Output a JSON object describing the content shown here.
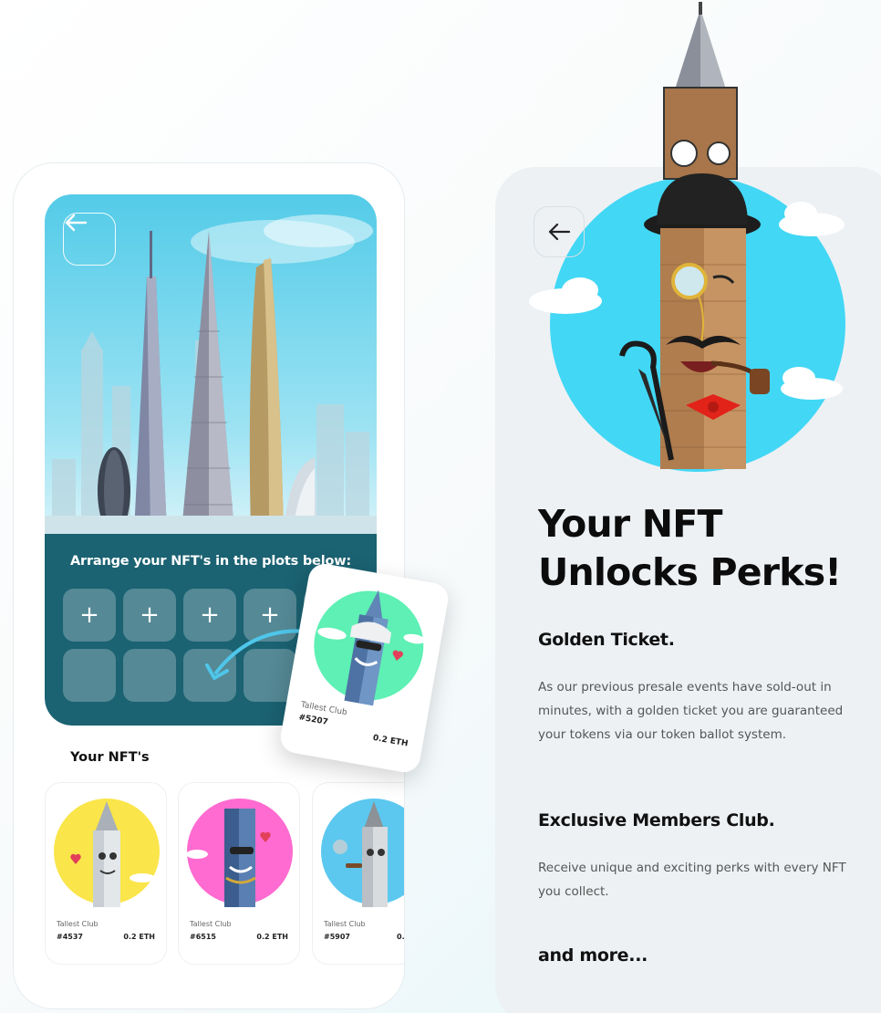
{
  "left_screen": {
    "back_icon": "arrow-left-icon",
    "plots_title": "Arrange your NFT's in the plots below:",
    "plot_add_symbol": "+",
    "nfts_title": "Your NFT's",
    "dragged_card": {
      "name": "Tallest Club",
      "id": "#5207",
      "price": "0.2 ETH",
      "bg_color": "#5ef0b4"
    },
    "nft_cards": [
      {
        "name": "Tallest Club",
        "id": "#4537",
        "price": "0.2 ETH",
        "bg_color": "#fae54a"
      },
      {
        "name": "Tallest Club",
        "id": "#6515",
        "price": "0.2 ETH",
        "bg_color": "#ff6bd0"
      },
      {
        "name": "Tallest Club",
        "id": "#5907",
        "price": "0.",
        "bg_color": "#5cc8ef"
      }
    ]
  },
  "right_screen": {
    "back_icon": "arrow-left-icon",
    "title_line1": "Your NFT",
    "title_line2": "Unlocks Perks!",
    "section1_title": "Golden Ticket.",
    "section1_body": "As our previous presale events have sold-out in minutes, with a golden ticket you are guaranteed your tokens via our token ballot system.",
    "section2_title": "Exclusive Members Club.",
    "section2_body": "Receive unique and exciting perks with every NFT you collect.",
    "section3_title": "and more...",
    "hero_bg_color": "#42d7f5"
  },
  "colors": {
    "accent_teal": "#1b6272",
    "drag_arrow": "#4fc6ea"
  }
}
